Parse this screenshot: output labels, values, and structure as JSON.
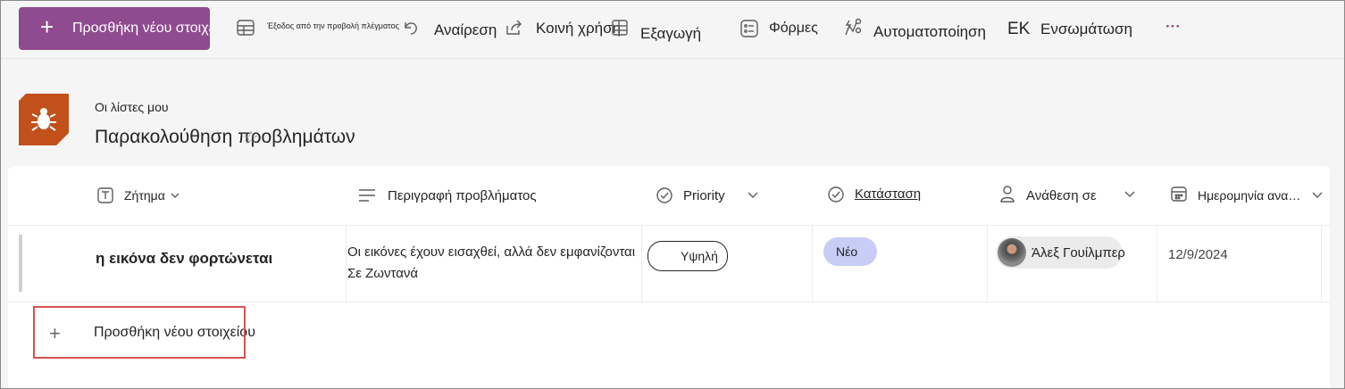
{
  "toolbar": {
    "new_item": "Προσθήκη νέου στοιχείου",
    "exit_grid": "Έξοδος από την προβολή πλέγματος",
    "undo": "Αναίρεση",
    "share": "Κοινή χρήση",
    "export": "Εξαγωγή",
    "forms": "Φόρμες",
    "automate": "Αυτοματοποίηση",
    "embed_prefix": "ΕΚ",
    "embed": "Ενσωμάτωση",
    "more": "···"
  },
  "header": {
    "breadcrumb": "Οι λίστες μου",
    "title": "Παρακολούθηση προβλημάτων"
  },
  "columns": [
    {
      "label": "Ζήτημα",
      "icon": "text-icon"
    },
    {
      "label": "Περιγραφή προβλήματος",
      "icon": "lines-icon"
    },
    {
      "label": "Priority",
      "icon": "check-circle-icon"
    },
    {
      "label": "Κατάσταση",
      "icon": "check-circle-icon"
    },
    {
      "label": "Ανάθεση σε",
      "icon": "person-icon"
    },
    {
      "label": "Ημερομηνία αναφοράς",
      "icon": "calendar-icon"
    }
  ],
  "rows": [
    {
      "issue": "η εικόνα δεν φορτώνεται",
      "description_line1": "Οι εικόνες έχουν εισαχθεί, αλλά δεν εμφανίζονται",
      "description_line2": "Σε Ζωντανά",
      "priority": "Υψηλή",
      "status": "Νέο",
      "assigned": "Άλεξ Γουίλμπερ",
      "date": "12/9/2024"
    }
  ],
  "add_row": {
    "label": "Προσθήκη νέου στοιχείου"
  },
  "colors": {
    "new_button": "#8f4b8f",
    "list_icon": "#c2501b",
    "status_pill": "#c7cdf4",
    "highlight": "#d9534f"
  }
}
